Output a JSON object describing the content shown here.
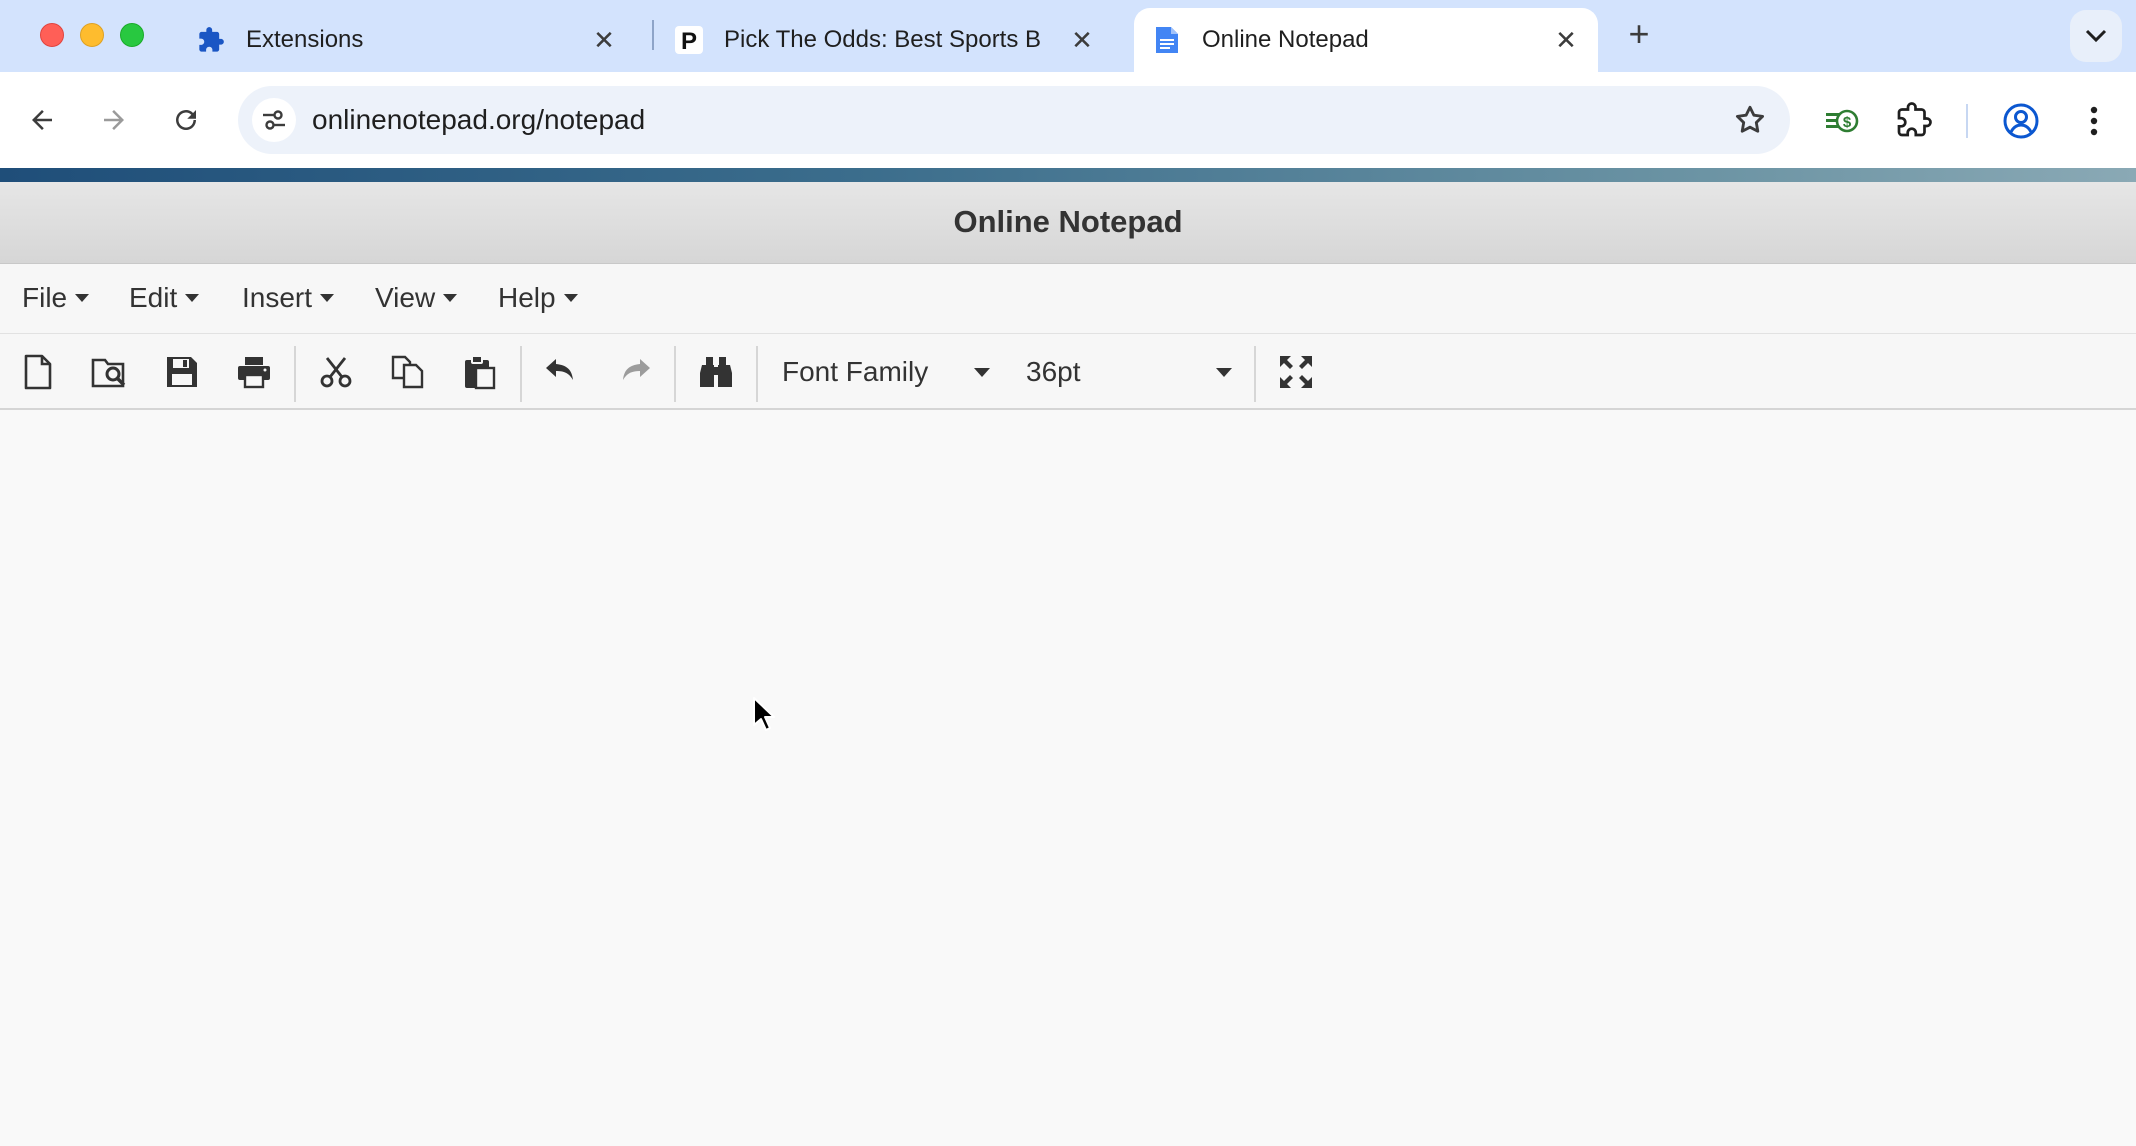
{
  "browser": {
    "tabs": [
      {
        "title": "Extensions",
        "icon": "puzzle-icon"
      },
      {
        "title": "Pick The Odds: Best Sports B",
        "icon": "p-logo-icon"
      },
      {
        "title": "Online Notepad",
        "icon": "document-icon",
        "active": true
      }
    ],
    "close_glyph": "✕",
    "new_tab_glyph": "+",
    "url": "onlinenotepad.org/notepad"
  },
  "app": {
    "title": "Online Notepad",
    "menus": [
      "File",
      "Edit",
      "Insert",
      "View",
      "Help"
    ],
    "toolbar": {
      "font_family": "Font Family",
      "font_size": "36pt",
      "buttons": [
        "new-document",
        "open-file",
        "save",
        "print",
        "cut",
        "copy",
        "paste",
        "undo",
        "redo",
        "find",
        "fullscreen"
      ]
    }
  },
  "colors": {
    "tabstrip": "#d3e3fd",
    "omnibox": "#edf2fa",
    "accent_blue": "#0b57d0",
    "header_gradient": "#1f4e79"
  }
}
